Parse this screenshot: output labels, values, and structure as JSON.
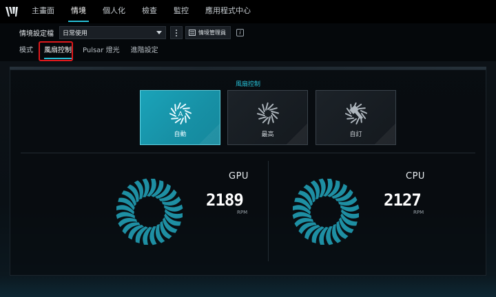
{
  "nav": {
    "items": [
      {
        "label": "主畫面",
        "active": false
      },
      {
        "label": "情境",
        "active": true
      },
      {
        "label": "個人化",
        "active": false
      },
      {
        "label": "檢查",
        "active": false
      },
      {
        "label": "監控",
        "active": false
      },
      {
        "label": "應用程式中心",
        "active": false
      }
    ]
  },
  "profile": {
    "label": "情境設定檔",
    "selected": "日常使用",
    "manager_label": "情境管理員",
    "info": "i"
  },
  "subtabs": [
    {
      "label": "模式",
      "active": false
    },
    {
      "label": "風扇控制",
      "active": true
    },
    {
      "label": "Pulsar 燈光",
      "active": false
    },
    {
      "label": "進階設定",
      "active": false
    }
  ],
  "fan_control": {
    "title": "風扇控制",
    "modes": [
      {
        "label": "自動",
        "active": true,
        "icon": "fan-auto-icon"
      },
      {
        "label": "最高",
        "active": false,
        "icon": "fan-max-icon"
      },
      {
        "label": "自訂",
        "active": false,
        "icon": "fan-custom-icon"
      }
    ]
  },
  "gpu": {
    "label": "GPU",
    "speed": "2189",
    "unit": "RPM"
  },
  "cpu": {
    "label": "CPU",
    "speed": "2127",
    "unit": "RPM"
  },
  "colors": {
    "accent": "#27c1d8",
    "active_card": "#1aa3b9",
    "highlight": "#e0181c"
  }
}
